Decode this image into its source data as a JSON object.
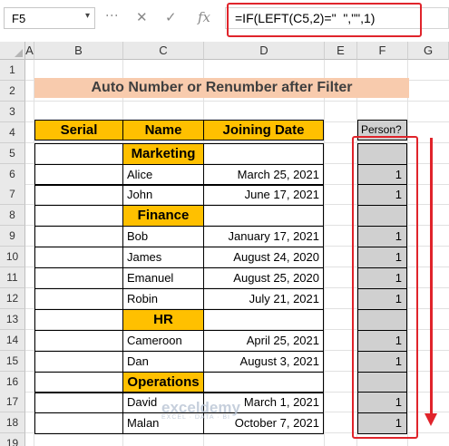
{
  "formula_bar": {
    "name_box": "F5",
    "cancel_icon": "✕",
    "enter_icon": "✓",
    "fx_label": "fx",
    "formula": "=IF(LEFT(C5,2)=\"  \",\"\",1)"
  },
  "columns": [
    "A",
    "B",
    "C",
    "D",
    "E",
    "F",
    "G"
  ],
  "rows": [
    "1",
    "2",
    "3",
    "4",
    "5",
    "6",
    "7",
    "8",
    "9",
    "10",
    "11",
    "12",
    "13",
    "14",
    "15",
    "16",
    "17",
    "18",
    "19"
  ],
  "title": "Auto Number or Renumber after Filter",
  "table": {
    "headers": {
      "serial": "Serial",
      "name": "Name",
      "joining_date": "Joining Date"
    },
    "rows": [
      {
        "department": "Marketing"
      },
      {
        "name": "Alice",
        "date": "March 25, 2021",
        "person": "1"
      },
      {
        "name": "John",
        "date": "June 17, 2021",
        "person": "1"
      },
      {
        "department": "Finance"
      },
      {
        "name": "Bob",
        "date": "January 17, 2021",
        "person": "1"
      },
      {
        "name": "James",
        "date": "August 24, 2020",
        "person": "1"
      },
      {
        "name": "Emanuel",
        "date": "August 25, 2020",
        "person": "1"
      },
      {
        "name": "Robin",
        "date": "July 21, 2021",
        "person": "1"
      },
      {
        "department": "HR"
      },
      {
        "name": "Cameroon",
        "date": "April 25, 2021",
        "person": "1"
      },
      {
        "name": "Dan",
        "date": "August 3, 2021",
        "person": "1"
      },
      {
        "department": "Operations"
      },
      {
        "name": "David",
        "date": "March 1, 2021",
        "person": "1"
      },
      {
        "name": "Malan",
        "date": "October 7, 2021",
        "person": "1"
      }
    ]
  },
  "person_header": "Person?",
  "watermark": {
    "brand": "exceldemy",
    "tagline": "EXCEL · DATA · BI"
  },
  "colors": {
    "header_fill": "#ffc000",
    "title_fill": "#f8cbad",
    "highlight": "#e0242b",
    "helper_fill": "#d0d0d0"
  }
}
